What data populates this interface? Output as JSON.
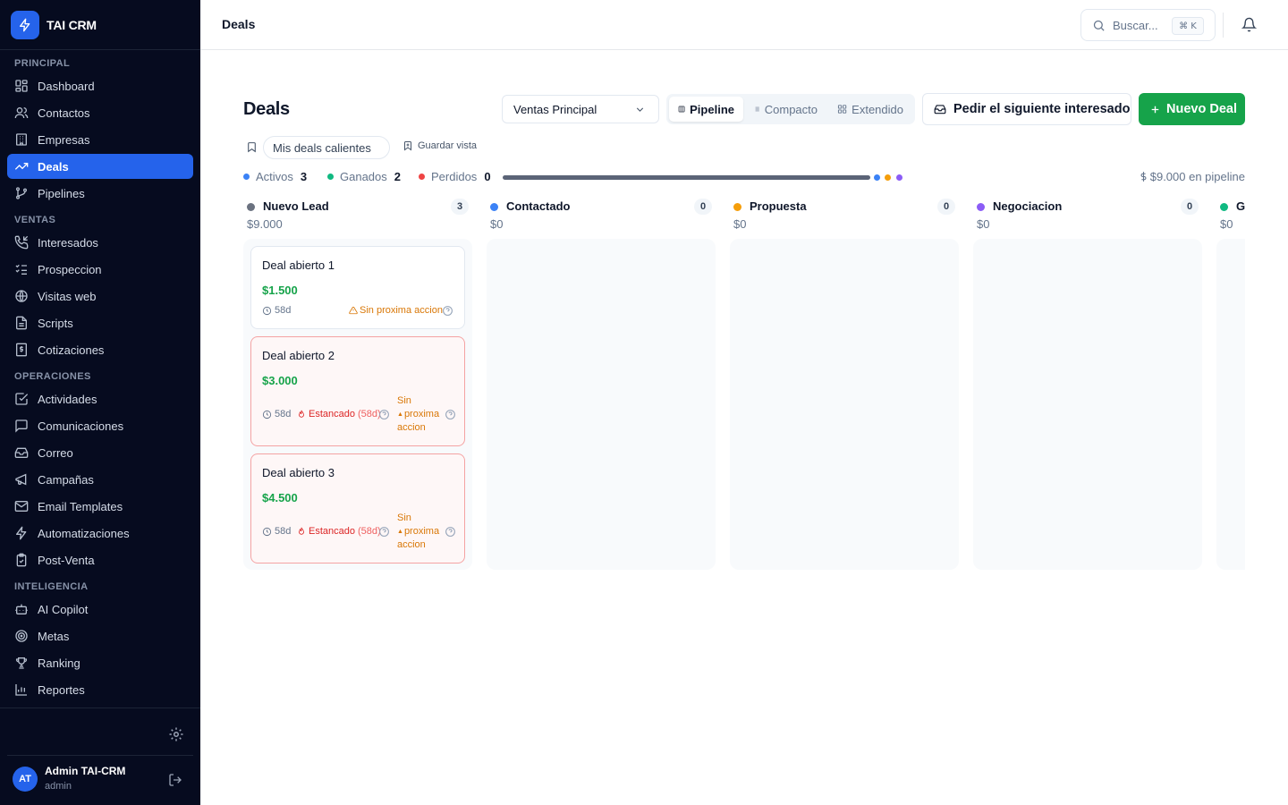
{
  "app": {
    "name": "TAI CRM",
    "colors": {
      "primary": "#2563eb",
      "success": "#16a34a",
      "danger": "#dc2626",
      "warning": "#d97706",
      "sidebar_bg": "#060b1f"
    }
  },
  "sidebar": {
    "sections": [
      {
        "title": "PRINCIPAL",
        "items": [
          {
            "label": "Dashboard",
            "icon": "dashboard-icon"
          },
          {
            "label": "Contactos",
            "icon": "users-icon"
          },
          {
            "label": "Empresas",
            "icon": "building-icon"
          },
          {
            "label": "Deals",
            "icon": "trending-up-icon",
            "active": true
          },
          {
            "label": "Pipelines",
            "icon": "git-branch-icon"
          }
        ]
      },
      {
        "title": "VENTAS",
        "items": [
          {
            "label": "Interesados",
            "icon": "phone-incoming-icon"
          },
          {
            "label": "Prospeccion",
            "icon": "list-checks-icon"
          },
          {
            "label": "Visitas web",
            "icon": "globe-icon"
          },
          {
            "label": "Scripts",
            "icon": "file-text-icon"
          },
          {
            "label": "Cotizaciones",
            "icon": "receipt-icon"
          }
        ]
      },
      {
        "title": "OPERACIONES",
        "items": [
          {
            "label": "Actividades",
            "icon": "check-square-icon"
          },
          {
            "label": "Comunicaciones",
            "icon": "message-square-icon"
          },
          {
            "label": "Correo",
            "icon": "inbox-icon"
          },
          {
            "label": "Campañas",
            "icon": "megaphone-icon"
          },
          {
            "label": "Email Templates",
            "icon": "mail-icon"
          },
          {
            "label": "Automatizaciones",
            "icon": "zap-icon"
          },
          {
            "label": "Post-Venta",
            "icon": "clipboard-check-icon"
          }
        ]
      },
      {
        "title": "INTELIGENCIA",
        "items": [
          {
            "label": "AI Copilot",
            "icon": "bot-icon"
          },
          {
            "label": "Metas",
            "icon": "target-icon"
          },
          {
            "label": "Ranking",
            "icon": "trophy-icon"
          },
          {
            "label": "Reportes",
            "icon": "bar-chart-icon"
          }
        ]
      }
    ],
    "user": {
      "initials": "AT",
      "name": "Admin TAI-CRM",
      "role": "admin"
    }
  },
  "header": {
    "title": "Deals",
    "search_placeholder": "Buscar...",
    "shortcut": "⌘ K"
  },
  "main": {
    "title": "Deals",
    "pipeline_select": "Ventas Principal",
    "views": [
      "Pipeline",
      "Compacto",
      "Extendido"
    ],
    "active_view": "Pipeline",
    "next_lead_button": "Pedir el siguiente interesado",
    "new_deal_button": "Nuevo Deal",
    "saved_view_chip": "Mis deals calientes",
    "save_view_label": "Guardar vista",
    "stats": {
      "active_label": "Activos",
      "active_count": "3",
      "won_label": "Ganados",
      "won_count": "2",
      "lost_label": "Perdidos",
      "lost_count": "0",
      "pipeline_total": "$9.000 en pipeline"
    },
    "stages": [
      {
        "name": "Nuevo Lead",
        "count": "3",
        "amount": "$9.000",
        "color": "#6b7280"
      },
      {
        "name": "Contactado",
        "count": "0",
        "amount": "$0",
        "color": "#3b82f6"
      },
      {
        "name": "Propuesta",
        "count": "0",
        "amount": "$0",
        "color": "#f59e0b"
      },
      {
        "name": "Negociacion",
        "count": "0",
        "amount": "$0",
        "color": "#8b5cf6"
      },
      {
        "name": "Ganado",
        "count": "",
        "amount": "$0",
        "color": "#10b981"
      }
    ],
    "deals": [
      {
        "title": "Deal abierto 1",
        "amount": "$1.500",
        "age": "58d",
        "stalled": false,
        "warning": "Sin proxima accion"
      },
      {
        "title": "Deal abierto 2",
        "amount": "$3.000",
        "age": "58d",
        "stalled": true,
        "stalled_label": "Estancado",
        "stalled_days": "(58d)",
        "warning": "Sin proxima accion",
        "warning_lines": [
          "Sin",
          "proxima",
          "accion"
        ]
      },
      {
        "title": "Deal abierto 3",
        "amount": "$4.500",
        "age": "58d",
        "stalled": true,
        "stalled_label": "Estancado",
        "stalled_days": "(58d)",
        "warning": "Sin proxima accion",
        "warning_lines": [
          "Sin",
          "proxima",
          "accion"
        ]
      }
    ]
  }
}
